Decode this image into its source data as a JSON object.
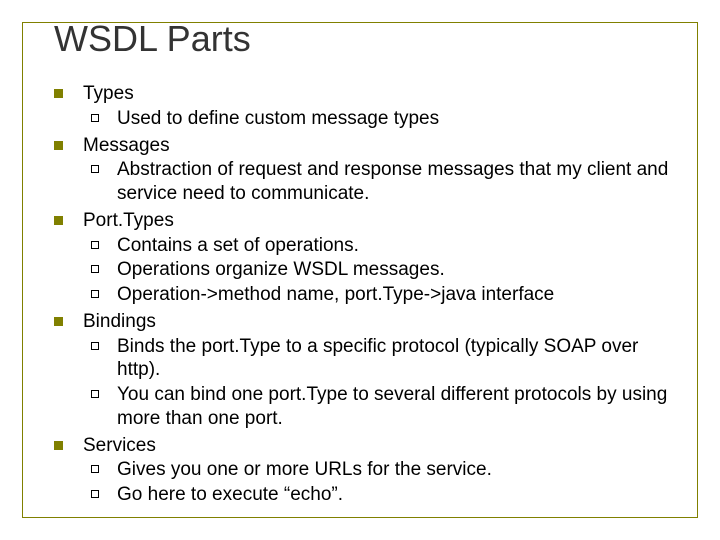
{
  "slide": {
    "title": "WSDL Parts",
    "items": [
      {
        "label": "Types",
        "sub": [
          "Used to define custom message types"
        ]
      },
      {
        "label": "Messages",
        "sub": [
          "Abstraction of request and response messages that my client and service need to communicate."
        ]
      },
      {
        "label": "Port.Types",
        "sub": [
          "Contains a set of operations.",
          "Operations organize WSDL messages.",
          "Operation->method name, port.Type->java interface"
        ]
      },
      {
        "label": "Bindings",
        "sub": [
          "Binds the port.Type to a specific protocol (typically SOAP over http).",
          "You can bind one port.Type to several different protocols by using more than one port."
        ]
      },
      {
        "label": "Services",
        "sub": [
          "Gives you one or more URLs for the service.",
          "Go here to execute “echo”."
        ]
      }
    ]
  }
}
